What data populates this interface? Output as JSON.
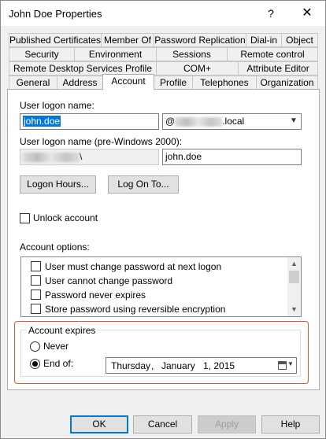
{
  "window": {
    "title": "John Doe Properties",
    "help_glyph": "?",
    "close_glyph": "✕"
  },
  "tabs": {
    "row1": [
      "Published Certificates",
      "Member Of",
      "Password Replication",
      "Dial-in",
      "Object"
    ],
    "row2": [
      "Security",
      "Environment",
      "Sessions",
      "Remote control"
    ],
    "row3": [
      "Remote Desktop Services Profile",
      "COM+",
      "Attribute Editor"
    ],
    "row4": [
      "General",
      "Address",
      "Account",
      "Profile",
      "Telephones",
      "Organization"
    ],
    "active": "Account"
  },
  "account": {
    "logon_name_label": "User logon name:",
    "logon_name_value": "john.doe",
    "domain_prefix": "@",
    "domain_suffix": ".local",
    "pre2000_label": "User logon name (pre-Windows 2000):",
    "pre2000_domain_suffix": "\\",
    "pre2000_value": "john.doe",
    "logon_hours_button": "Logon Hours...",
    "log_on_to_button": "Log On To...",
    "unlock_label": "Unlock account",
    "options_label": "Account options:",
    "options": [
      "User must change password at next logon",
      "User cannot change password",
      "Password never expires",
      "Store password using reversible encryption"
    ],
    "expires": {
      "title": "Account expires",
      "never_label": "Never",
      "endof_label": "End of:",
      "selected": "End of:",
      "date": {
        "weekday": "Thursday",
        "sep1": ",",
        "month": "January",
        "day_year": "1, 2015"
      }
    }
  },
  "buttons": {
    "ok": "OK",
    "cancel": "Cancel",
    "apply": "Apply",
    "help": "Help"
  },
  "colors": {
    "accent": "#0078d7",
    "highlight_border": "#e0562b"
  }
}
